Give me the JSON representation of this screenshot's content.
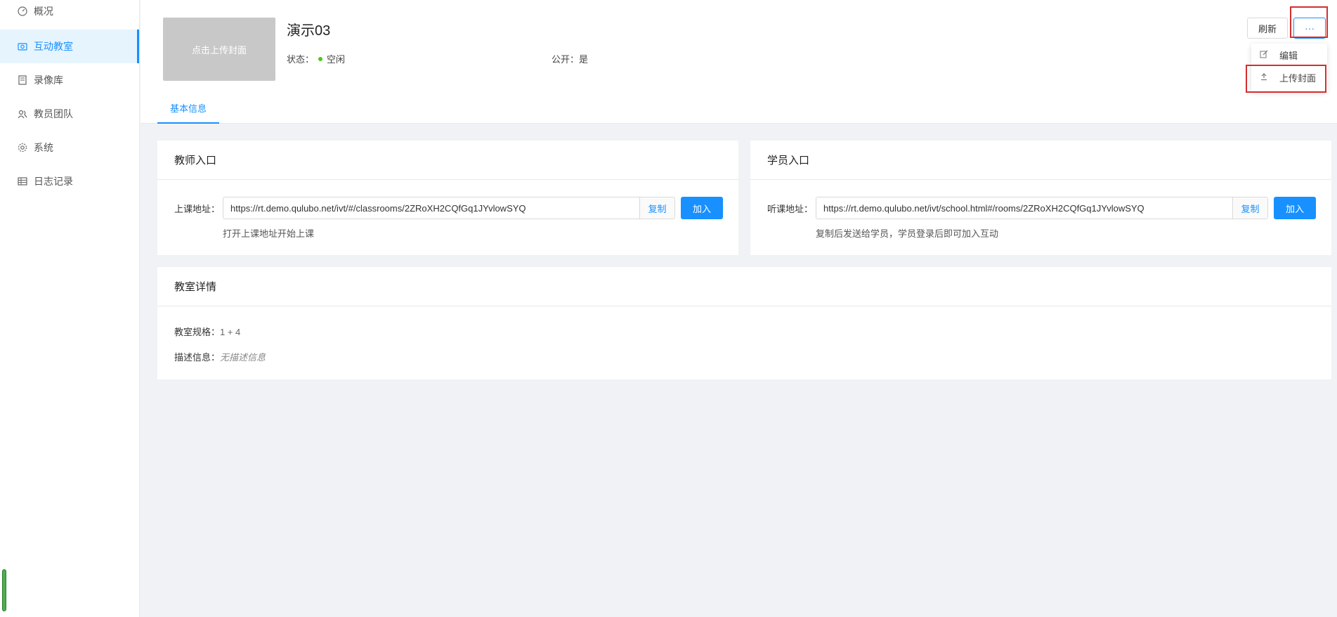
{
  "sidebar": {
    "items": [
      {
        "label": "概况",
        "icon": "dashboard-icon"
      },
      {
        "label": "互动教室",
        "icon": "camera-icon"
      },
      {
        "label": "录像库",
        "icon": "book-icon"
      },
      {
        "label": "教员团队",
        "icon": "team-icon"
      },
      {
        "label": "系统",
        "icon": "gear-icon"
      },
      {
        "label": "日志记录",
        "icon": "table-icon"
      }
    ],
    "active_index": 1
  },
  "header": {
    "cover_label": "点击上传封面",
    "title": "演示03",
    "status_label": "状态：",
    "status_value": "空闲",
    "public_label": "公开：",
    "public_value": "是",
    "refresh_label": "刷新",
    "more_label": "···",
    "tab_label": "基本信息"
  },
  "dropdown": {
    "items": [
      {
        "label": "编辑",
        "icon": "edit-icon"
      },
      {
        "label": "上传封面",
        "icon": "upload-icon"
      }
    ]
  },
  "teacher": {
    "title": "教师入口",
    "label": "上课地址：",
    "url": "https://rt.demo.qulubo.net/ivt/#/classrooms/2ZRoXH2CQfGq1JYvlowSYQ",
    "copy_label": "复制",
    "join_label": "加入",
    "hint": "打开上课地址开始上课"
  },
  "student": {
    "title": "学员入口",
    "label": "听课地址：",
    "url": "https://rt.demo.qulubo.net/ivt/school.html#/rooms/2ZRoXH2CQfGq1JYvlowSYQ",
    "copy_label": "复制",
    "join_label": "加入",
    "hint": "复制后发送给学员，学员登录后即可加入互动"
  },
  "details": {
    "title": "教室详情",
    "spec_label": "教室规格：",
    "spec_value": "1 + 4",
    "desc_label": "描述信息：",
    "desc_value": "无描述信息"
  },
  "colors": {
    "primary": "#1890ff",
    "status_idle": "#52c41a",
    "highlight": "#d32f2f"
  }
}
